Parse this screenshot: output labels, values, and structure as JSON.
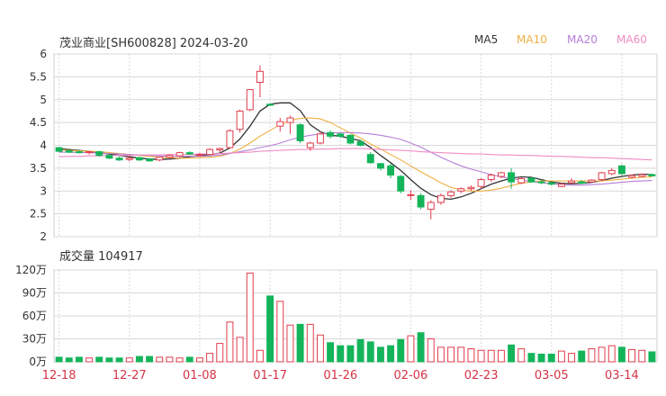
{
  "header": {
    "title": "茂业商业[SH600828] 2024-03-20"
  },
  "legend": [
    {
      "label": "MA5",
      "color": "#333333"
    },
    {
      "label": "MA10",
      "color": "#f0b040"
    },
    {
      "label": "MA20",
      "color": "#b67ed8"
    },
    {
      "label": "MA60",
      "color": "#f08cc4"
    }
  ],
  "volume_panel": {
    "title": "成交量 104917"
  },
  "colors": {
    "up": "#e03c4c",
    "down": "#14b45a",
    "grid": "#d8d8d8",
    "axis": "#888888"
  },
  "chart_data": [
    {
      "type": "candlestick",
      "title": "茂业商业[SH600828] 2024-03-20",
      "ylim": [
        2,
        6
      ],
      "yticks": [
        "6",
        "5.5",
        "5",
        "4.5",
        "4",
        "3.5",
        "3",
        "2.5",
        "2"
      ],
      "xtick_labels": [
        "12-18",
        "12-27",
        "01-08",
        "01-17",
        "01-26",
        "02-06",
        "02-23",
        "03-05",
        "03-14"
      ],
      "xtick_index": [
        0,
        7,
        14,
        21,
        28,
        35,
        42,
        49,
        56
      ],
      "series_ohlc": [
        [
          3.95,
          3.97,
          3.85,
          3.87
        ],
        [
          3.88,
          3.91,
          3.83,
          3.85
        ],
        [
          3.86,
          3.89,
          3.82,
          3.84
        ],
        [
          3.84,
          3.88,
          3.8,
          3.86
        ],
        [
          3.86,
          3.88,
          3.75,
          3.78
        ],
        [
          3.78,
          3.8,
          3.7,
          3.72
        ],
        [
          3.72,
          3.75,
          3.66,
          3.68
        ],
        [
          3.69,
          3.76,
          3.65,
          3.72
        ],
        [
          3.73,
          3.75,
          3.66,
          3.68
        ],
        [
          3.7,
          3.72,
          3.64,
          3.66
        ],
        [
          3.68,
          3.75,
          3.65,
          3.74
        ],
        [
          3.74,
          3.8,
          3.72,
          3.78
        ],
        [
          3.77,
          3.86,
          3.74,
          3.84
        ],
        [
          3.84,
          3.87,
          3.79,
          3.81
        ],
        [
          3.79,
          3.83,
          3.76,
          3.8
        ],
        [
          3.8,
          3.94,
          3.79,
          3.91
        ],
        [
          3.9,
          3.95,
          3.85,
          3.93
        ],
        [
          3.95,
          4.35,
          3.93,
          4.32
        ],
        [
          4.35,
          4.78,
          4.28,
          4.75
        ],
        [
          4.78,
          5.22,
          4.75,
          5.22
        ],
        [
          5.38,
          5.75,
          5.05,
          5.62
        ],
        [
          4.9,
          4.92,
          4.86,
          4.89
        ],
        [
          4.42,
          4.6,
          4.3,
          4.52
        ],
        [
          4.5,
          4.65,
          4.25,
          4.6
        ],
        [
          4.45,
          4.48,
          4.05,
          4.1
        ],
        [
          3.95,
          4.08,
          3.88,
          4.05
        ],
        [
          4.05,
          4.3,
          4.02,
          4.25
        ],
        [
          4.28,
          4.33,
          4.15,
          4.2
        ],
        [
          4.25,
          4.28,
          4.16,
          4.2
        ],
        [
          4.22,
          4.24,
          4.02,
          4.05
        ],
        [
          4.08,
          4.12,
          3.98,
          4.0
        ],
        [
          3.8,
          3.85,
          3.6,
          3.62
        ],
        [
          3.6,
          3.62,
          3.45,
          3.5
        ],
        [
          3.55,
          3.6,
          3.28,
          3.35
        ],
        [
          3.32,
          3.35,
          2.95,
          3.0
        ],
        [
          2.9,
          3.02,
          2.8,
          2.92
        ],
        [
          2.9,
          2.95,
          2.6,
          2.65
        ],
        [
          2.6,
          2.8,
          2.38,
          2.75
        ],
        [
          2.75,
          2.95,
          2.7,
          2.9
        ],
        [
          2.9,
          3.02,
          2.85,
          2.98
        ],
        [
          3.0,
          3.08,
          2.95,
          3.05
        ],
        [
          3.05,
          3.12,
          3.0,
          3.08
        ],
        [
          3.1,
          3.28,
          3.05,
          3.25
        ],
        [
          3.25,
          3.38,
          3.2,
          3.35
        ],
        [
          3.32,
          3.42,
          3.28,
          3.4
        ],
        [
          3.4,
          3.5,
          3.05,
          3.2
        ],
        [
          3.18,
          3.3,
          3.15,
          3.27
        ],
        [
          3.28,
          3.3,
          3.18,
          3.2
        ],
        [
          3.2,
          3.25,
          3.15,
          3.18
        ],
        [
          3.18,
          3.2,
          3.12,
          3.15
        ],
        [
          3.1,
          3.18,
          3.08,
          3.15
        ],
        [
          3.18,
          3.28,
          3.15,
          3.22
        ],
        [
          3.2,
          3.24,
          3.15,
          3.17
        ],
        [
          3.2,
          3.26,
          3.18,
          3.24
        ],
        [
          3.25,
          3.42,
          3.22,
          3.4
        ],
        [
          3.38,
          3.5,
          3.35,
          3.45
        ],
        [
          3.55,
          3.58,
          3.35,
          3.38
        ],
        [
          3.3,
          3.36,
          3.28,
          3.34
        ],
        [
          3.32,
          3.38,
          3.3,
          3.36
        ],
        [
          3.36,
          3.38,
          3.32,
          3.33
        ]
      ],
      "ma": {
        "MA5": [
          3.93,
          3.91,
          3.89,
          3.87,
          3.84,
          3.81,
          3.78,
          3.75,
          3.72,
          3.7,
          3.69,
          3.7,
          3.72,
          3.75,
          3.78,
          3.8,
          3.83,
          3.94,
          4.14,
          4.42,
          4.75,
          4.9,
          4.93,
          4.93,
          4.76,
          4.45,
          4.3,
          4.22,
          4.2,
          4.15,
          4.1,
          3.95,
          3.78,
          3.62,
          3.45,
          3.25,
          3.06,
          2.92,
          2.84,
          2.82,
          2.87,
          2.95,
          3.05,
          3.15,
          3.22,
          3.28,
          3.31,
          3.3,
          3.25,
          3.2,
          3.17,
          3.16,
          3.17,
          3.19,
          3.23,
          3.28,
          3.32,
          3.35,
          3.37,
          3.36
        ],
        "MA10": [
          3.9,
          3.89,
          3.88,
          3.87,
          3.86,
          3.84,
          3.82,
          3.8,
          3.78,
          3.76,
          3.74,
          3.73,
          3.72,
          3.72,
          3.73,
          3.74,
          3.76,
          3.82,
          3.92,
          4.05,
          4.2,
          4.33,
          4.45,
          4.55,
          4.59,
          4.6,
          4.58,
          4.5,
          4.38,
          4.27,
          4.16,
          4.03,
          3.92,
          3.8,
          3.68,
          3.55,
          3.42,
          3.3,
          3.18,
          3.08,
          3.02,
          3.0,
          3.0,
          3.02,
          3.06,
          3.12,
          3.17,
          3.2,
          3.22,
          3.22,
          3.22,
          3.22,
          3.22,
          3.22,
          3.22,
          3.24,
          3.26,
          3.28,
          3.3,
          3.31
        ],
        "MA20": [
          3.85,
          3.85,
          3.84,
          3.84,
          3.83,
          3.82,
          3.81,
          3.8,
          3.79,
          3.78,
          3.77,
          3.76,
          3.76,
          3.76,
          3.76,
          3.77,
          3.79,
          3.82,
          3.86,
          3.9,
          3.95,
          3.99,
          4.05,
          4.12,
          4.18,
          4.22,
          4.25,
          4.27,
          4.28,
          4.28,
          4.27,
          4.25,
          4.22,
          4.18,
          4.13,
          4.05,
          3.96,
          3.85,
          3.74,
          3.64,
          3.55,
          3.48,
          3.42,
          3.36,
          3.31,
          3.27,
          3.24,
          3.21,
          3.18,
          3.16,
          3.14,
          3.13,
          3.13,
          3.14,
          3.15,
          3.17,
          3.19,
          3.21,
          3.22,
          3.23
        ],
        "MA60": [
          3.75,
          3.76,
          3.76,
          3.77,
          3.77,
          3.78,
          3.78,
          3.78,
          3.79,
          3.79,
          3.79,
          3.8,
          3.8,
          3.8,
          3.81,
          3.81,
          3.82,
          3.83,
          3.84,
          3.85,
          3.87,
          3.88,
          3.89,
          3.9,
          3.91,
          3.91,
          3.92,
          3.92,
          3.93,
          3.93,
          3.93,
          3.92,
          3.91,
          3.9,
          3.89,
          3.88,
          3.86,
          3.85,
          3.84,
          3.83,
          3.82,
          3.81,
          3.81,
          3.8,
          3.79,
          3.79,
          3.78,
          3.78,
          3.77,
          3.76,
          3.76,
          3.75,
          3.74,
          3.73,
          3.73,
          3.72,
          3.71,
          3.7,
          3.69,
          3.68
        ]
      }
    },
    {
      "type": "bar",
      "title": "成交量 104917",
      "ylim": [
        0,
        120
      ],
      "yticks": [
        "120万",
        "90万",
        "60万",
        "30万",
        "0万"
      ],
      "volumes_wan": [
        6,
        5,
        6,
        5,
        6,
        5,
        5,
        5,
        7,
        7,
        6,
        6,
        5,
        6,
        5,
        11,
        24,
        52,
        32,
        116,
        15,
        86,
        79,
        48,
        49,
        49,
        35,
        25,
        21,
        21,
        29,
        26,
        19,
        21,
        29,
        34,
        38,
        30,
        19,
        19,
        19,
        17,
        15,
        15,
        15,
        22,
        17,
        11,
        10,
        10,
        14,
        11,
        14,
        17,
        19,
        21,
        19,
        16,
        15,
        13
      ]
    }
  ]
}
